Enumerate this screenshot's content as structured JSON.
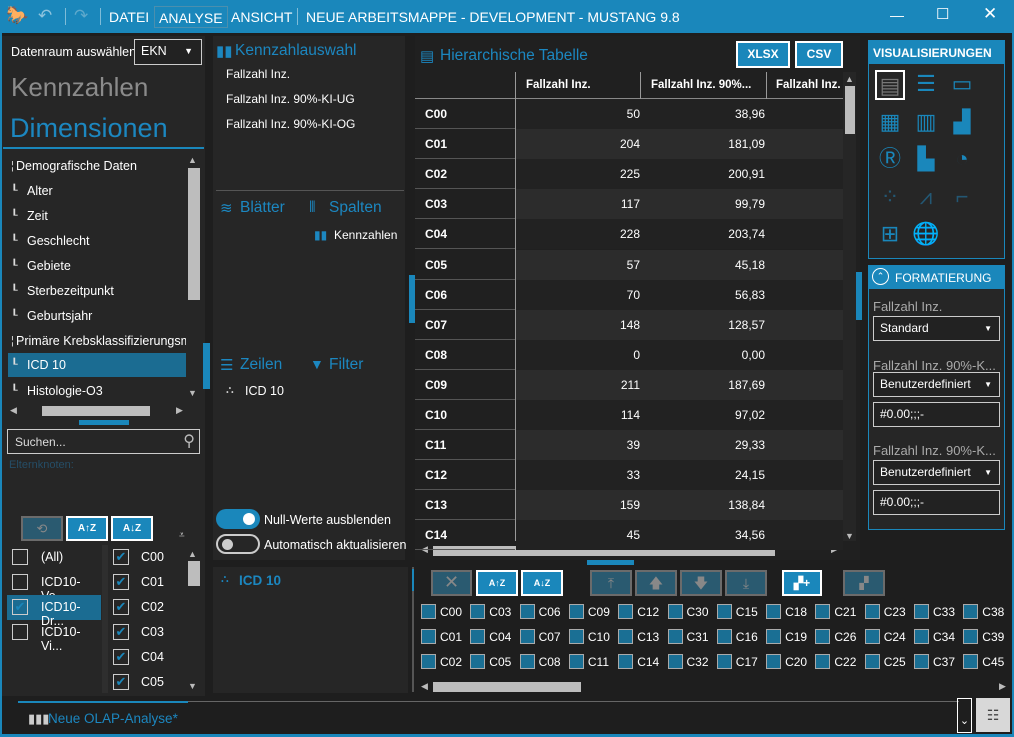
{
  "titlebar": {
    "menu": [
      "DATEI",
      "ANALYSE",
      "ANSICHT"
    ],
    "title": "NEUE ARBEITSMAPPE - DEVELOPMENT - MUSTANG 9.8",
    "accent": "#1a87bb"
  },
  "left": {
    "datenraum_label": "Datenraum auswählen",
    "datenraum_value": "EKN",
    "kennzahlen": "Kennzahlen",
    "dimensionen": "Dimensionen",
    "tree": [
      "Demografische Daten",
      "Alter",
      "Zeit",
      "Geschlecht",
      "Gebiete",
      "Sterbezeitpunkt",
      "Geburtsjahr",
      "Primäre Krebsklassifizierungsmer",
      "ICD 10",
      "Histologie-O3"
    ],
    "search_placeholder": "Suchen...",
    "elternknoten": "Elternknoten:",
    "levels": [
      {
        "label": "(All)",
        "checked": false
      },
      {
        "label": "ICD10-Vo...",
        "checked": false
      },
      {
        "label": "ICD10-Dr...",
        "checked": true
      },
      {
        "label": "ICD10-Vi...",
        "checked": false
      }
    ],
    "members": [
      "C00",
      "C01",
      "C02",
      "C03",
      "C04",
      "C05"
    ]
  },
  "middle": {
    "kennzahlauswahl": "Kennzahlauswahl",
    "measures": [
      "Fallzahl Inz.",
      "Fallzahl Inz. 90%-KI-UG",
      "Fallzahl Inz. 90%-KI-OG"
    ],
    "blaetter": "Blätter",
    "spalten": "Spalten",
    "spalten_item": "Kennzahlen",
    "zeilen": "Zeilen",
    "filter": "Filter",
    "zeilen_item": "ICD 10",
    "toggle_null": "Null-Werte ausblenden",
    "toggle_null_on": true,
    "toggle_auto": "Automatisch aktualisieren",
    "toggle_auto_on": false,
    "bottom_dim": "ICD 10"
  },
  "table": {
    "title": "Hierarchische Tabelle",
    "xlsx": "XLSX",
    "csv": "CSV",
    "columns": [
      "Fallzahl Inz.",
      "Fallzahl Inz. 90%...",
      "Fallzahl Inz."
    ],
    "rows": [
      [
        "C00",
        "50",
        "38,96"
      ],
      [
        "C01",
        "204",
        "181,09"
      ],
      [
        "C02",
        "225",
        "200,91"
      ],
      [
        "C03",
        "117",
        "99,79"
      ],
      [
        "C04",
        "228",
        "203,74"
      ],
      [
        "C05",
        "57",
        "45,18"
      ],
      [
        "C06",
        "70",
        "56,83"
      ],
      [
        "C07",
        "148",
        "128,57"
      ],
      [
        "C08",
        "0",
        "0,00"
      ],
      [
        "C09",
        "211",
        "187,69"
      ],
      [
        "C10",
        "114",
        "97,02"
      ],
      [
        "C11",
        "39",
        "29,33"
      ],
      [
        "C12",
        "33",
        "24,15"
      ],
      [
        "C13",
        "159",
        "138,84"
      ],
      [
        "C14",
        "45",
        "34,56"
      ]
    ]
  },
  "right": {
    "visualisierungen": "VISUALISIERUNGEN",
    "formatierung": "FORMATIERUNG",
    "fmt": [
      {
        "label": "Fallzahl Inz.",
        "select": "Standard"
      },
      {
        "label": "Fallzahl Inz. 90%-K...",
        "select": "Benutzerdefiniert",
        "pattern": "#0.00;;;-"
      },
      {
        "label": "Fallzahl Inz. 90%-K...",
        "select": "Benutzerdefiniert",
        "pattern": "#0.00;;;-"
      }
    ]
  },
  "bottom": {
    "members": [
      "C00",
      "C03",
      "C06",
      "C09",
      "C12",
      "C30",
      "C15",
      "C18",
      "C21",
      "C23",
      "C33",
      "C38",
      "C01",
      "C04",
      "C07",
      "C10",
      "C13",
      "C31",
      "C16",
      "C19",
      "C26",
      "C24",
      "C34",
      "C39",
      "C02",
      "C05",
      "C08",
      "C11",
      "C14",
      "C32",
      "C17",
      "C20",
      "C22",
      "C25",
      "C37",
      "C45"
    ]
  },
  "status": {
    "tab": "Neue OLAP-Analyse*"
  }
}
